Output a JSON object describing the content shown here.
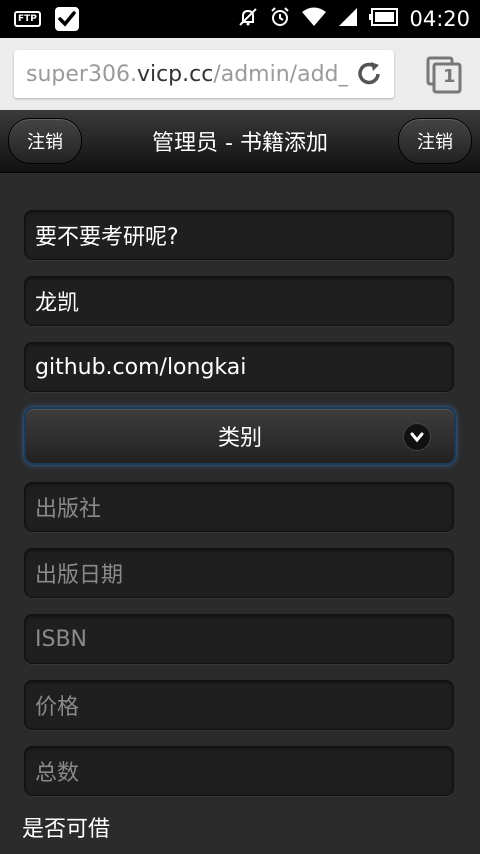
{
  "status_bar": {
    "ftp_label": "FTP",
    "time": "04:20",
    "icons": [
      "ftp-icon",
      "check-icon",
      "muted-icon",
      "alarm-icon",
      "wifi-icon",
      "signal-icon",
      "battery-icon"
    ]
  },
  "browser": {
    "url_prefix": "super306.",
    "url_host": "vicp.cc",
    "url_suffix": "/admin/add_b",
    "tab_count": "1"
  },
  "header": {
    "left_button": "注销",
    "title": "管理员 - 书籍添加",
    "right_button": "注销"
  },
  "form": {
    "fields": [
      {
        "value": "要不要考研呢?",
        "placeholder": ""
      },
      {
        "value": "龙凯",
        "placeholder": ""
      },
      {
        "value": "github.com/longkai",
        "placeholder": ""
      }
    ],
    "category_select": "类别",
    "placeholders": {
      "publisher": "出版社",
      "publish_date": "出版日期",
      "isbn": "ISBN",
      "price": "价格",
      "total": "总数"
    },
    "borrowable_label": "是否可借"
  },
  "colors": {
    "header_bg": "#1a1a1a",
    "content_bg": "#2b2b2b",
    "field_bg": "#1f1f1f",
    "focus_glow": "#3a6ea5"
  }
}
